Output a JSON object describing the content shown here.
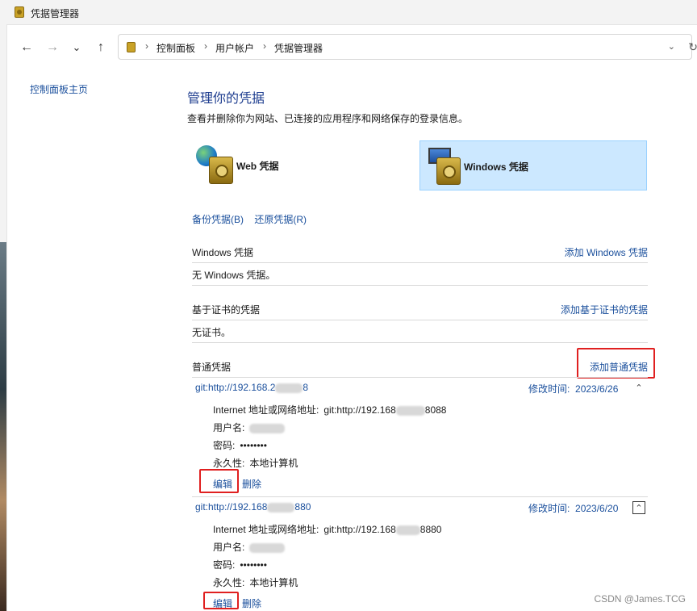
{
  "window": {
    "title": "凭据管理器"
  },
  "nav": {
    "back_icon": "←",
    "forward_icon": "→",
    "recent_icon": "⌄",
    "up_icon": "↑"
  },
  "address": {
    "sep_icon": "›",
    "crumbs": [
      "控制面板",
      "用户帐户",
      "凭据管理器"
    ],
    "dropdown_icon": "⌄",
    "refresh_icon": "↻"
  },
  "sidebar": {
    "home_link": "控制面板主页"
  },
  "main": {
    "heading": "管理你的凭据",
    "description": "查看并删除你为网站、已连接的应用程序和网络保存的登录信息。",
    "tabs": {
      "web": "Web 凭据",
      "windows": "Windows 凭据"
    },
    "backup_link": "备份凭据(B)",
    "restore_link": "还原凭据(R)",
    "windows_section": {
      "title": "Windows 凭据",
      "action": "添加 Windows 凭据",
      "empty": "无 Windows 凭据。"
    },
    "cert_section": {
      "title": "基于证书的凭据",
      "action": "添加基于证书的凭据",
      "empty": "无证书。"
    },
    "generic_section": {
      "title": "普通凭据",
      "action": "添加普通凭据",
      "modified_label": "修改时间:",
      "collapse_icon": "⌃",
      "address_label": "Internet 地址或网络地址:",
      "username_label": "用户名:",
      "password_label": "密码:",
      "persistence_label": "永久性:",
      "edit_label": "编辑",
      "delete_label": "删除",
      "items": [
        {
          "name_a": "git:http://192.168.2",
          "name_b": "8",
          "date": "2023/6/26",
          "address_a": "git:http://192.168",
          "address_b": "8088",
          "password": "••••••••",
          "persistence": "本地计算机"
        },
        {
          "name_a": "git:http://192.168",
          "name_b": "880",
          "date": "2023/6/20",
          "address_a": "git:http://192.168",
          "address_b": "8880",
          "password": "••••••••",
          "persistence": "本地计算机"
        }
      ]
    }
  },
  "watermark": "CSDN @James.TCG"
}
